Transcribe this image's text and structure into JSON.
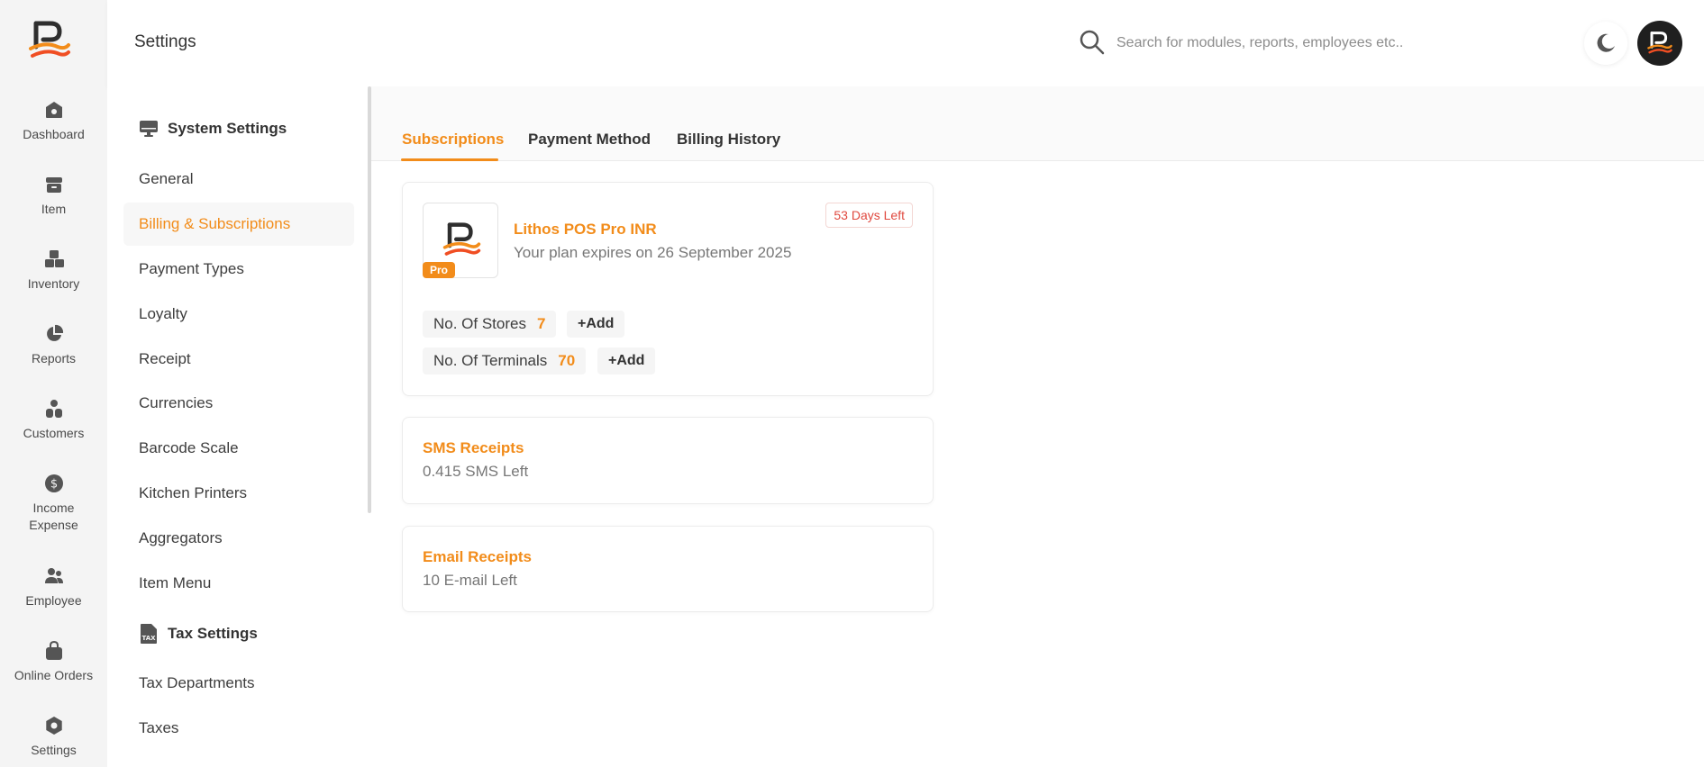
{
  "colors": {
    "accent": "#f28c1a",
    "danger": "#e0493f",
    "rail_bg": "#f4f4f4",
    "icon": "#555555"
  },
  "header": {
    "title": "Settings",
    "search_placeholder": "Search for modules, reports, employees etc..",
    "search_icon": "search-icon",
    "theme_icon": "moon-icon"
  },
  "rail": {
    "items": [
      {
        "label": "Dashboard",
        "icon": "home-icon"
      },
      {
        "label": "Item",
        "icon": "archive-icon"
      },
      {
        "label": "Inventory",
        "icon": "boxes-icon"
      },
      {
        "label": "Reports",
        "icon": "pie-chart-icon"
      },
      {
        "label": "Customers",
        "icon": "customer-icon"
      },
      {
        "label": "Income\nExpense",
        "icon": "dollar-icon"
      },
      {
        "label": "Employee",
        "icon": "users-icon"
      },
      {
        "label": "Online Orders",
        "icon": "shopping-bag-icon"
      },
      {
        "label": "Settings",
        "icon": "gear-icon"
      }
    ]
  },
  "settings_nav": {
    "system_heading": "System Settings",
    "system_items": [
      "General",
      "Billing & Subscriptions",
      "Payment Types",
      "Loyalty",
      "Receipt",
      "Currencies",
      "Barcode Scale",
      "Kitchen Printers",
      "Aggregators",
      "Item Menu"
    ],
    "active_item": "Billing & Subscriptions",
    "tax_heading": "Tax Settings",
    "tax_items": [
      "Tax Departments",
      "Taxes"
    ]
  },
  "tabs": {
    "items": [
      "Subscriptions",
      "Payment Method",
      "Billing History"
    ],
    "active": "Subscriptions"
  },
  "subscription": {
    "badge": "Pro",
    "plan_name": "Lithos POS Pro INR",
    "expiry": "Your plan expires on 26 September 2025",
    "days_left": "53 Days Left",
    "stores_label": "No. Of Stores",
    "stores_count": "7",
    "terminals_label": "No. Of Terminals",
    "terminals_count": "70",
    "add_label": "+Add"
  },
  "sms": {
    "title": "SMS Receipts",
    "subtitle": "0.415 SMS Left"
  },
  "email": {
    "title": "Email Receipts",
    "subtitle": "10 E-mail Left"
  }
}
